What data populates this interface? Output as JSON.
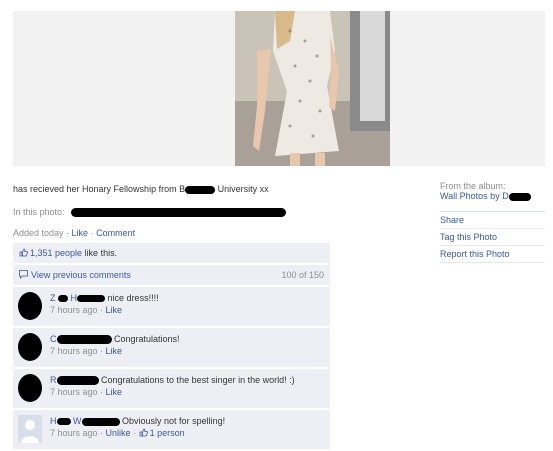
{
  "photo": {
    "icon": "photo-of-person-in-floral-dress"
  },
  "caption": {
    "text_before": "has recieved her Honary Fellowship from B",
    "text_after": " University xx"
  },
  "tagged": {
    "label": "In this photo:"
  },
  "added": {
    "time": "Added today",
    "sep1": " · ",
    "like": "Like",
    "sep2": " · ",
    "comment": "Comment"
  },
  "sidebar": {
    "album_label": "From the album:",
    "album_link": "Wall Photos by D",
    "actions": [
      "Share",
      "Tag this Photo",
      "Report this Photo"
    ]
  },
  "likes": {
    "count_text": "1,351 people",
    "suffix": " like this."
  },
  "view_previous": {
    "label": "View previous comments",
    "count": "100 of 150"
  },
  "comments": [
    {
      "name_initial": "Z",
      "name_mid": "H",
      "text": "nice dress!!!!",
      "time": "7 hours ago",
      "action": "Like",
      "extra": ""
    },
    {
      "name_initial": "C",
      "name_mid": "",
      "text": "Congratulations!",
      "time": "7 hours ago",
      "action": "Like",
      "extra": ""
    },
    {
      "name_initial": "R",
      "name_mid": "",
      "text": "Congratulations to the best singer in the world! :)",
      "time": "7 hours ago",
      "action": "Like",
      "extra": ""
    },
    {
      "name_initial": "H",
      "name_mid": "W",
      "text": "Obviously not for spelling!",
      "time": "7 hours ago",
      "action": "Unlike",
      "extra": "1 person"
    }
  ],
  "colors": {
    "link": "#3b5998",
    "ufi_bg": "#edeff4",
    "muted": "#8f8f8f"
  }
}
